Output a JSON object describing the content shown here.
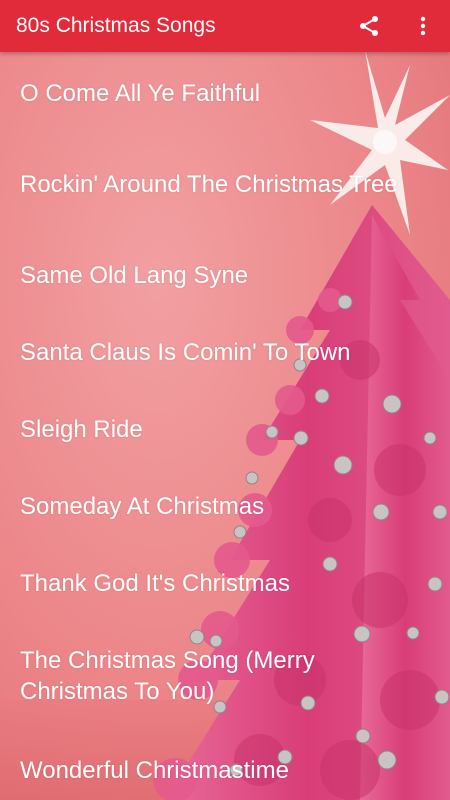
{
  "app_bar": {
    "title": "80s Christmas Songs",
    "share_icon": "share-icon",
    "more_icon": "more-vert-icon",
    "background_color": "#e12b3a"
  },
  "songs": [
    {
      "title": "O Come All Ye Faithful"
    },
    {
      "title": "Rockin' Around The Christmas Tree"
    },
    {
      "title": "Same Old Lang Syne"
    },
    {
      "title": "Santa Claus Is Comin' To Town"
    },
    {
      "title": "Sleigh Ride"
    },
    {
      "title": "Someday At Christmas"
    },
    {
      "title": "Thank God It's Christmas"
    },
    {
      "title": "The Christmas Song (Merry Christmas To You)"
    },
    {
      "title": "Wonderful Christmastime"
    }
  ],
  "background": {
    "description_icon": "pink-christmas-tree-image",
    "wall_color": "#ec8a8e",
    "tree_color": "#e0457e",
    "star_color": "#fbf1ee"
  }
}
